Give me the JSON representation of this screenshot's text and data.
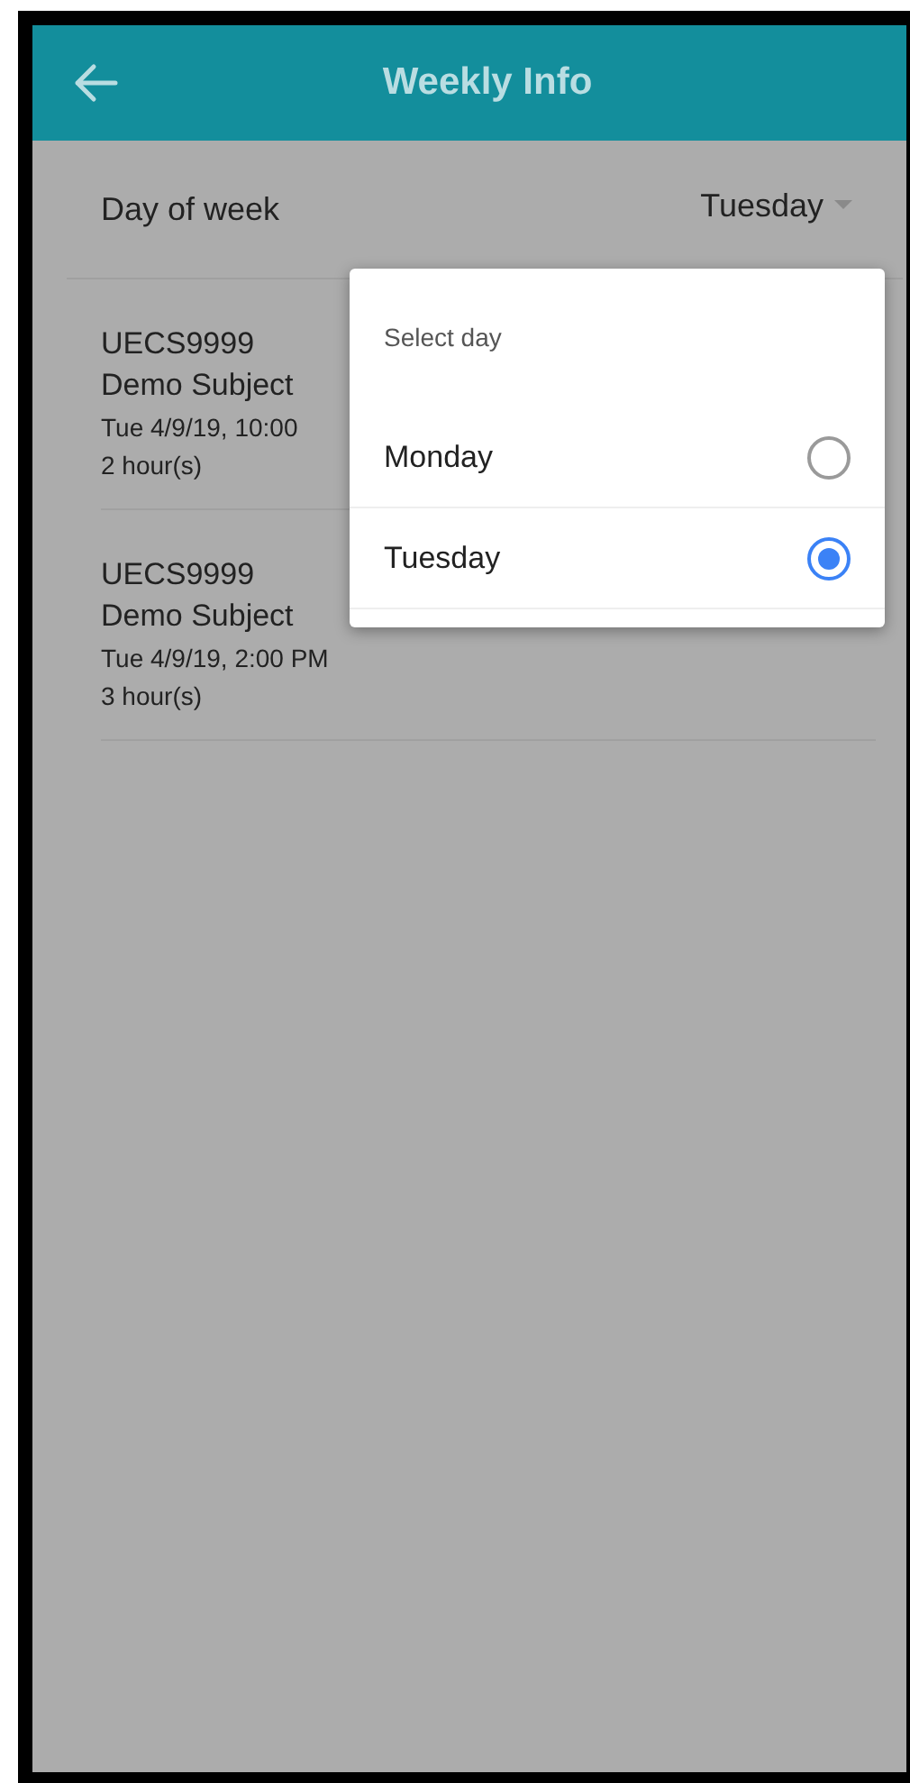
{
  "header": {
    "title": "Weekly Info"
  },
  "filter": {
    "label": "Day of week",
    "value": "Tuesday"
  },
  "classes": [
    {
      "code": "UECS9999",
      "subject": "Demo Subject",
      "time": "Tue 4/9/19, 10:00",
      "duration": "2 hour(s)"
    },
    {
      "code": "UECS9999",
      "subject": "Demo Subject",
      "time": "Tue 4/9/19, 2:00 PM",
      "duration": "3 hour(s)"
    }
  ],
  "popup": {
    "title": "Select day",
    "options": [
      {
        "label": "Monday",
        "selected": false
      },
      {
        "label": "Tuesday",
        "selected": true
      }
    ]
  }
}
